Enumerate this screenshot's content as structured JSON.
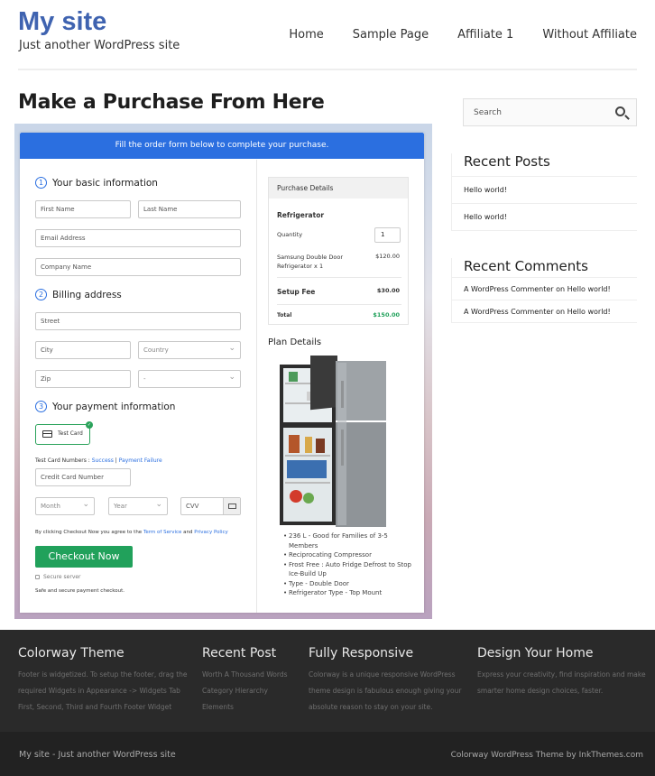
{
  "site": {
    "title": "My site",
    "tagline": "Just another WordPress site"
  },
  "nav": {
    "items": [
      "Home",
      "Sample Page",
      "Affiliate 1",
      "Without Affiliate"
    ]
  },
  "page": {
    "title": "Make a Purchase From Here"
  },
  "order_form": {
    "banner": "Fill the order form below to complete your purchase.",
    "steps": [
      {
        "num": "1",
        "label": "Your basic information"
      },
      {
        "num": "2",
        "label": "Billing address"
      },
      {
        "num": "3",
        "label": "Your payment information"
      }
    ],
    "placeholders": {
      "first_name": "First Name",
      "last_name": "Last Name",
      "email": "Email Address",
      "company": "Company Name",
      "street": "Street",
      "city": "City",
      "country": "Country",
      "zip": "Zip",
      "state": "-",
      "card_number": "Credit Card Number",
      "month": "Month",
      "year": "Year",
      "cvv": "CVV"
    },
    "test_card_label": "Test Card",
    "test_card_numbers": {
      "prefix": "Test Card Numbers : ",
      "success": "Success",
      "separator": " | ",
      "failure": "Payment Failure"
    },
    "terms": {
      "prefix": "By clicking Checkout Now you agree to the ",
      "tos": "Term of Service",
      "and": " and ",
      "privacy": "Privacy Policy"
    },
    "checkout_button": "Checkout Now",
    "secure_server": "Secure server",
    "secure_note": "Safe and secure payment checkout."
  },
  "purchase_details": {
    "heading": "Purchase Details",
    "product": "Refrigerator",
    "quantity_label": "Quantity",
    "quantity_value": "1",
    "item_name_1": "Samsung Double Door",
    "item_name_2": "Refrigerator x 1",
    "item_price": "$120.00",
    "setup_label": "Setup Fee",
    "setup_price": "$30.00",
    "total_label": "Total",
    "total_price": "$150.00"
  },
  "plan_details": {
    "heading": "Plan Details",
    "features": [
      "236 L - Good for Families of 3-5 Members",
      "Reciprocating Compressor",
      "Frost Free : Auto Fridge Defrost to Stop Ice-Build Up",
      "Type - Double Door",
      "Refrigerator Type - Top Mount"
    ]
  },
  "sidebar": {
    "search_placeholder": "Search",
    "recent_posts_heading": "Recent Posts",
    "recent_posts": [
      "Hello world!",
      "Hello world!"
    ],
    "recent_comments_heading": "Recent Comments",
    "recent_comments": [
      {
        "author": "A WordPress Commenter",
        "on": " on ",
        "post": "Hello world!"
      },
      {
        "author": "A WordPress Commenter",
        "on": " on ",
        "post": "Hello world!"
      }
    ]
  },
  "footer": {
    "columns": [
      {
        "title": "Colorway Theme",
        "lines": [
          "Footer is widgetized. To setup the footer, drag the",
          "required Widgets in Appearance -> Widgets Tab",
          "First, Second, Third and Fourth Footer Widget"
        ]
      },
      {
        "title": "Recent Post",
        "lines": [
          "Worth A Thousand Words",
          "Category Hierarchy",
          "Elements"
        ]
      },
      {
        "title": "Fully Responsive",
        "lines": [
          "Colorway is a unique responsive WordPress",
          "theme design is fabulous enough giving your",
          "absolute reason to stay on your site."
        ]
      },
      {
        "title": "Design Your Home",
        "lines": [
          "Express your creativity, find inspiration and make",
          "smarter home design choices, faster."
        ]
      }
    ],
    "bottom_left": "My site - Just another WordPress site",
    "bottom_right": "Colorway WordPress Theme by InkThemes.com"
  },
  "colors": {
    "accent": "#2b6fe0",
    "checkout": "#21a15b",
    "site_title": "#3f63b0",
    "footer_bg": "#2a2a2a"
  }
}
